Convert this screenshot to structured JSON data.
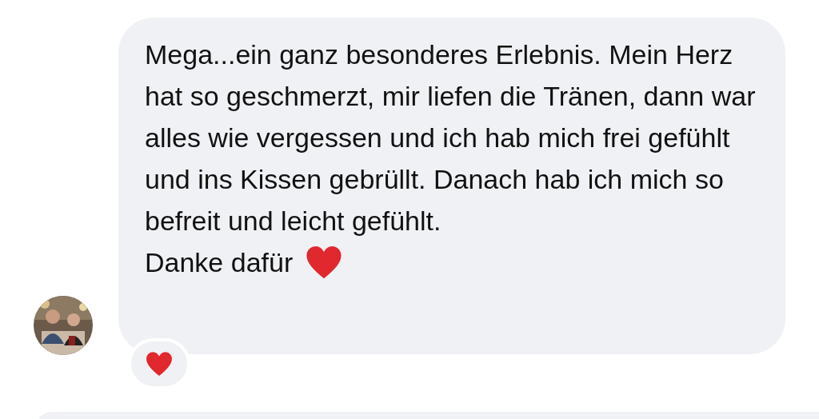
{
  "message": {
    "text": "Mega...ein ganz besonderes Erlebnis. Mein Herz hat so geschmerzt, mir liefen die Tränen, dann war alles wie vergessen und ich hab mich frei gefühlt und ins Kissen gebrüllt. Danach hab ich mich so befreit und leicht gefühlt.\nDanke dafür",
    "reactions": [
      {
        "kind": "heart"
      }
    ]
  }
}
